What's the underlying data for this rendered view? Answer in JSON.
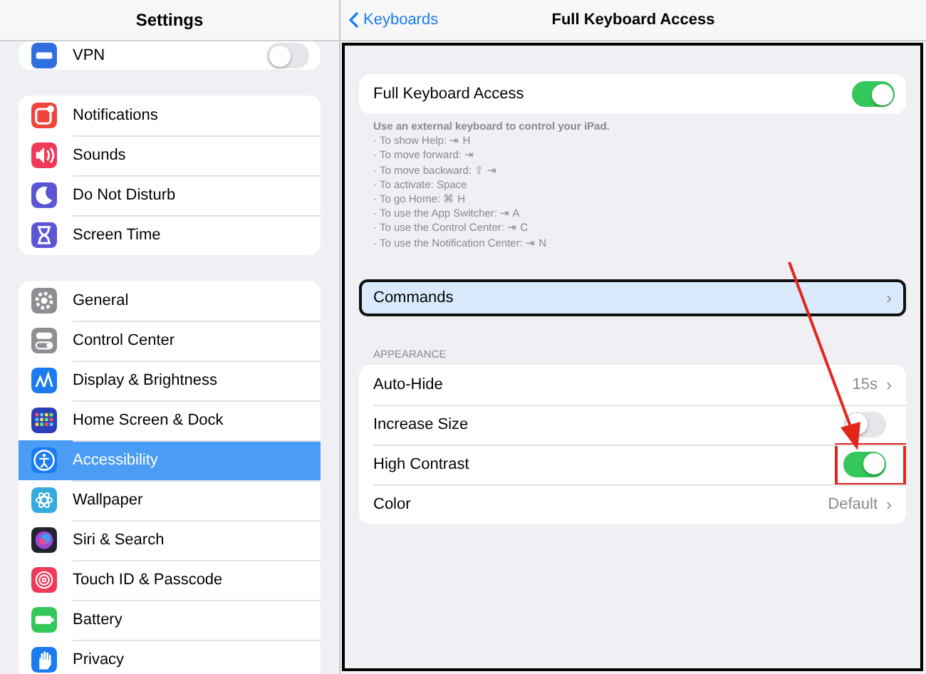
{
  "sidebar": {
    "title": "Settings",
    "groups": [
      {
        "items": [
          {
            "label": "VPN",
            "kind": "vpn",
            "color": "#2f6fe0",
            "selected": false,
            "toggle": {
              "on": false
            }
          }
        ]
      },
      {
        "items": [
          {
            "label": "Notifications",
            "kind": "notifications",
            "color": "#f0453a",
            "selected": false
          },
          {
            "label": "Sounds",
            "kind": "sounds",
            "color": "#f03a5a",
            "selected": false
          },
          {
            "label": "Do Not Disturb",
            "kind": "moon",
            "color": "#5b56d6",
            "selected": false
          },
          {
            "label": "Screen Time",
            "kind": "hourglass",
            "color": "#5b56d6",
            "selected": false
          }
        ]
      },
      {
        "items": [
          {
            "label": "General",
            "kind": "gear",
            "color": "#8e8e93",
            "selected": false
          },
          {
            "label": "Control Center",
            "kind": "switches",
            "color": "#8e8e93",
            "selected": false
          },
          {
            "label": "Display & Brightness",
            "kind": "textsize",
            "color": "#1a7cf0",
            "selected": false
          },
          {
            "label": "Home Screen & Dock",
            "kind": "grid",
            "color": "#2a3fb8",
            "selected": false
          },
          {
            "label": "Accessibility",
            "kind": "accessibility",
            "color": "#1a7cf0",
            "selected": true
          },
          {
            "label": "Wallpaper",
            "kind": "flower",
            "color": "#35aadc",
            "selected": false
          },
          {
            "label": "Siri & Search",
            "kind": "siri",
            "color": "#222233",
            "selected": false
          },
          {
            "label": "Touch ID & Passcode",
            "kind": "fingerprint",
            "color": "#f03a5a",
            "selected": false
          },
          {
            "label": "Battery",
            "kind": "battery",
            "color": "#34c759",
            "selected": false
          },
          {
            "label": "Privacy",
            "kind": "hand",
            "color": "#1a7cf0",
            "selected": false
          }
        ]
      }
    ]
  },
  "nav": {
    "back": "Keyboards",
    "title": "Full Keyboard Access"
  },
  "main": {
    "master": {
      "label": "Full Keyboard Access",
      "on": true
    },
    "footer": {
      "heading": "Use an external keyboard to control your iPad.",
      "lines": [
        "· To show Help: ⇥ H",
        "· To move forward: ⇥",
        "· To move backward: ⇧ ⇥",
        "· To activate: Space",
        "· To go Home: ⌘ H",
        "· To use the App Switcher: ⇥ A",
        "· To use the Control Center: ⇥ C",
        "· To use the Notification Center: ⇥ N"
      ]
    },
    "commands": {
      "label": "Commands",
      "focused": true,
      "chevron": "›"
    },
    "appearance": {
      "header": "APPEARANCE",
      "rows": [
        {
          "kind": "value",
          "label": "Auto-Hide",
          "value": "15s",
          "chevron": "›"
        },
        {
          "kind": "toggle",
          "label": "Increase Size",
          "on": false,
          "highlighted": false
        },
        {
          "kind": "toggle",
          "label": "High Contrast",
          "on": true,
          "highlighted": true
        },
        {
          "kind": "value",
          "label": "Color",
          "value": "Default",
          "chevron": "›"
        }
      ]
    }
  },
  "annotations": [
    {
      "kind": "arrow"
    }
  ]
}
